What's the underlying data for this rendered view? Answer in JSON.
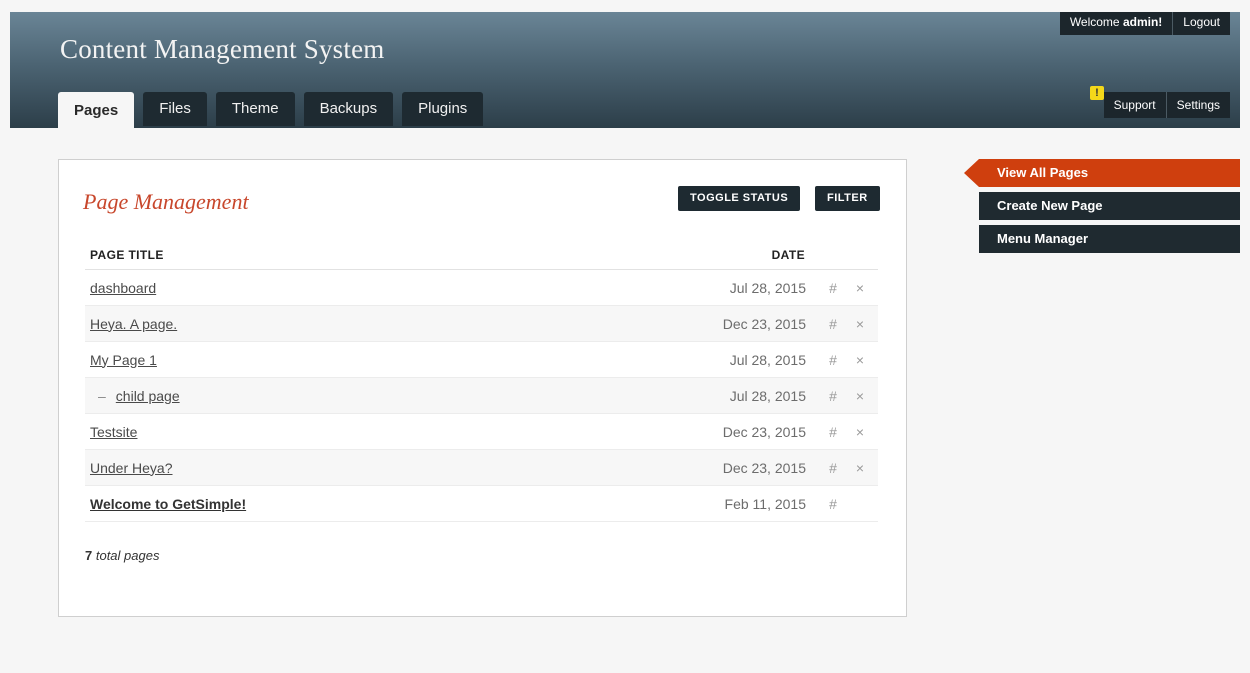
{
  "header": {
    "title": "Content Management System",
    "tabs": [
      "Pages",
      "Files",
      "Theme",
      "Backups",
      "Plugins"
    ],
    "active_tab": "Pages"
  },
  "userbar": {
    "welcome_prefix": "Welcome ",
    "username": "admin!",
    "logout": "Logout"
  },
  "utilbar": {
    "alert_glyph": "!",
    "support": "Support",
    "settings": "Settings"
  },
  "main": {
    "heading": "Page Management",
    "toggle_status": "TOGGLE STATUS",
    "filter": "FILTER",
    "col_title": "PAGE TITLE",
    "col_date": "DATE",
    "rows": [
      {
        "title": "dashboard",
        "date": "Jul 28, 2015",
        "hash": "#",
        "del": "×"
      },
      {
        "title": "Heya. A page.",
        "date": "Dec 23, 2015",
        "hash": "#",
        "del": "×"
      },
      {
        "title": "My Page 1",
        "date": "Jul 28, 2015",
        "hash": "#",
        "del": "×"
      },
      {
        "title": "child page",
        "dash": "–",
        "date": "Jul 28, 2015",
        "hash": "#",
        "del": "×"
      },
      {
        "title": "Testsite",
        "date": "Dec 23, 2015",
        "hash": "#",
        "del": "×"
      },
      {
        "title": "Under Heya?",
        "date": "Dec 23, 2015",
        "hash": "#",
        "del": "×"
      },
      {
        "title": "Welcome to GetSimple!",
        "date": "Feb 11, 2015",
        "hash": "#",
        "del": ""
      }
    ],
    "total_count": "7",
    "total_label": " total pages"
  },
  "sidebar": {
    "items": [
      "View All Pages",
      "Create New Page",
      "Menu Manager"
    ]
  }
}
